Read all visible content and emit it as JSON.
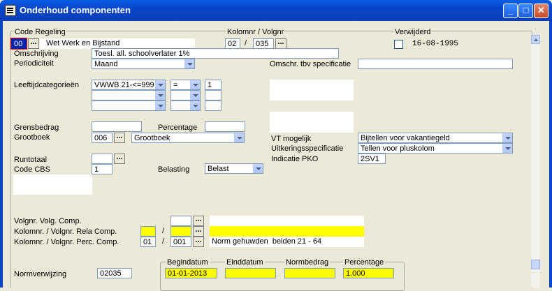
{
  "window": {
    "title": "Onderhoud componenten"
  },
  "labels": {
    "code_regeling": "Code Regeling",
    "kolomnr_volgnr": "Kolomnr / Volgnr",
    "verwijderd": "Verwijderd",
    "omschrijving": "Omschrijving",
    "periodiciteit": "Periodiciteit",
    "omschr_specificatie": "Omschr. tbv specificatie",
    "leeftijdcategorieen": "Leeftijdcategorieën",
    "grensbedrag": "Grensbedrag",
    "percentage": "Percentage",
    "grootboek": "Grootboek",
    "vt_mogelijk": "VT mogelijk",
    "uitkeringsspecificatie": "Uitkeringsspecificatie",
    "indicatie_pko": "Indicatie PKO",
    "runtotaal": "Runtotaal",
    "code_cbs": "Code CBS",
    "belasting": "Belasting",
    "volgnr_volg_comp": "Volgnr. Volg. Comp.",
    "kolomnr_rela_comp": "Kolomnr. / Volgnr. Rela Comp.",
    "kolomnr_perc_comp": "Kolomnr. / Volgnr. Perc. Comp.",
    "normverwijzing": "Normverwijzing",
    "slash": "/"
  },
  "fields": {
    "code_regeling": "00",
    "code_regeling_desc": "Wet Werk en Bijstand",
    "kolomnr": "02",
    "volgnr": "035",
    "verwijderd_date": "16-08-1995",
    "omschrijving": "Toesl. all. schoolverlater 1%",
    "periodiciteit": "Maand",
    "omschr_specificatie": "",
    "leeftijd_cat_1": "VWWB 21-<=999",
    "leeftijd_op_1": "=",
    "leeftijd_val_1": "1",
    "grensbedrag": "",
    "percentage": "",
    "grootboek_code": "006",
    "grootboek_name": "Grootboek",
    "vt_mogelijk": "Bijtellen voor vakantiegeld",
    "uitkeringsspecificatie": "Tellen voor pluskolom",
    "indicatie_pko": "2SV1",
    "runtotaal": "",
    "code_cbs": "1",
    "belasting": "Belast",
    "perc_comp_kolom": "01",
    "perc_comp_volg": "001",
    "perc_comp_desc": "Norm gehuwden  beiden 21 - 64",
    "normverwijzing": "02035"
  },
  "norm_table": {
    "headers": [
      "Begindatum",
      "Einddatum",
      "Normbedrag",
      "Percentage"
    ],
    "row": [
      "01-01-2013",
      "",
      "",
      "1.000"
    ]
  },
  "buttons": {
    "ellipsis": "..."
  },
  "window_buttons": {
    "minimize": "_",
    "maximize": "□",
    "close": "✕"
  }
}
